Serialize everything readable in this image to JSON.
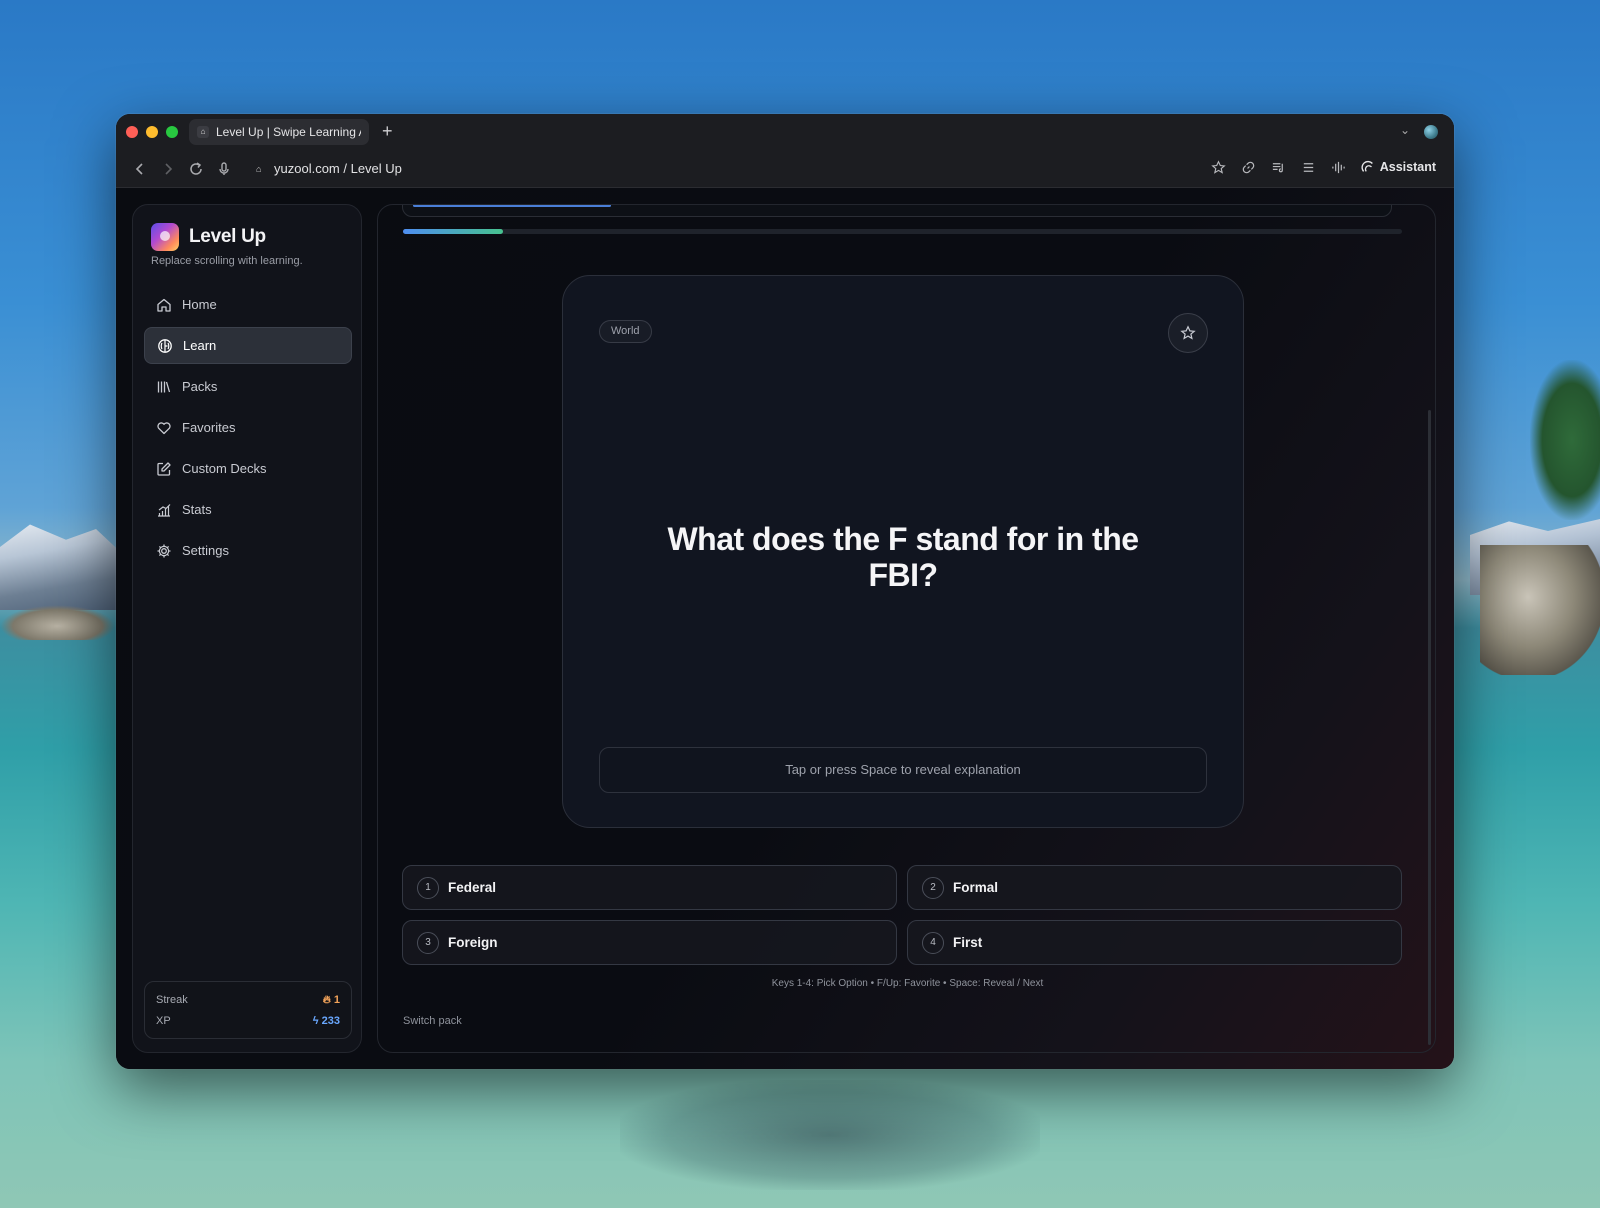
{
  "browser": {
    "tab_title": "Level Up | Swipe Learning Ap",
    "new_tab_symbol": "+",
    "url": "yuzool.com / Level Up",
    "assistant_label": "Assistant"
  },
  "sidebar": {
    "app_name": "Level Up",
    "tagline": "Replace scrolling with learning.",
    "items": [
      {
        "label": "Home",
        "icon": "home-icon",
        "active": false
      },
      {
        "label": "Learn",
        "icon": "brain-icon",
        "active": true
      },
      {
        "label": "Packs",
        "icon": "library-icon",
        "active": false
      },
      {
        "label": "Favorites",
        "icon": "heart-icon",
        "active": false
      },
      {
        "label": "Custom Decks",
        "icon": "edit-icon",
        "active": false
      },
      {
        "label": "Stats",
        "icon": "chart-icon",
        "active": false
      },
      {
        "label": "Settings",
        "icon": "gear-icon",
        "active": false
      }
    ],
    "streak_label": "Streak",
    "streak_value": "1",
    "xp_label": "XP",
    "xp_value": "233"
  },
  "main": {
    "progress_fraction": 0.1,
    "card": {
      "category": "World",
      "question": "What does the F stand for in the FBI?",
      "reveal_prompt": "Tap or press Space to reveal explanation"
    },
    "options": [
      {
        "number": "1",
        "label": "Federal"
      },
      {
        "number": "2",
        "label": "Formal"
      },
      {
        "number": "3",
        "label": "Foreign"
      },
      {
        "number": "4",
        "label": "First"
      }
    ],
    "hint": "Keys 1-4: Pick Option • F/Up: Favorite • Space: Reveal / Next",
    "switch_pack": "Switch pack"
  },
  "colors": {
    "accent_blue": "#4e8ef0",
    "accent_green": "#47c28f",
    "streak": "#f2a35a",
    "xp": "#6aa8ff"
  }
}
